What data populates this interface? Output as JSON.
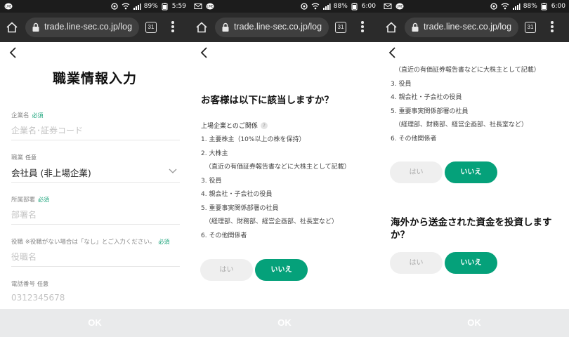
{
  "status_bars": [
    {
      "battery": "89%",
      "time": "5:59"
    },
    {
      "battery": "88%",
      "time": "6:00"
    },
    {
      "battery": "88%",
      "time": "6:00"
    }
  ],
  "browser": {
    "url": "trade.line-sec.co.jp/log",
    "tab_count": "31"
  },
  "form": {
    "title": "職業情報入力",
    "required_label": "必須",
    "optional_label": "任意",
    "fields": [
      {
        "label": "企業名",
        "tag": "必須",
        "placeholder": "企業名･証券コード"
      },
      {
        "label": "職業",
        "tag": "任意",
        "value": "会社員 (非上場企業)"
      },
      {
        "label": "所属部署",
        "tag": "必須",
        "placeholder": "部署名"
      },
      {
        "label": "役職 ※役職がない場合は「なし」とご入力ください。",
        "tag": "必須",
        "placeholder": "役職名"
      },
      {
        "label": "電話番号",
        "tag": "任意",
        "placeholder": "0312345678"
      }
    ]
  },
  "question1": {
    "title": "お客様は以下に該当しますか？",
    "sublabel": "上場企業とのご関係",
    "items": [
      "1. 主要株主（10%以上の株を保持）",
      "2. 大株主",
      "（直近の有価証券報告書などに大株主として記載）",
      "3. 役員",
      "4. 親会社・子会社の役員",
      "5. 重要事実関係部署の社員",
      "（経理部、財務部、経営企画部、社長室など）",
      "6. その他関係者"
    ]
  },
  "question1_continued": {
    "items": [
      "（直近の有価証券報告書などに大株主として記載）",
      "3. 役員",
      "4. 親会社・子会社の役員",
      "5. 重要事実関係部署の社員",
      "（経理部、財務部、経営企画部、社長室など）",
      "6. その他関係者"
    ]
  },
  "question2": {
    "title": "海外から送金された資金を投資しますか？"
  },
  "answers": {
    "yes": "はい",
    "no": "いいえ"
  },
  "ok_label": "OK",
  "colors": {
    "accent": "#05a17a",
    "required": "#1aa37a",
    "ok_bar": "#e9eaeb"
  }
}
